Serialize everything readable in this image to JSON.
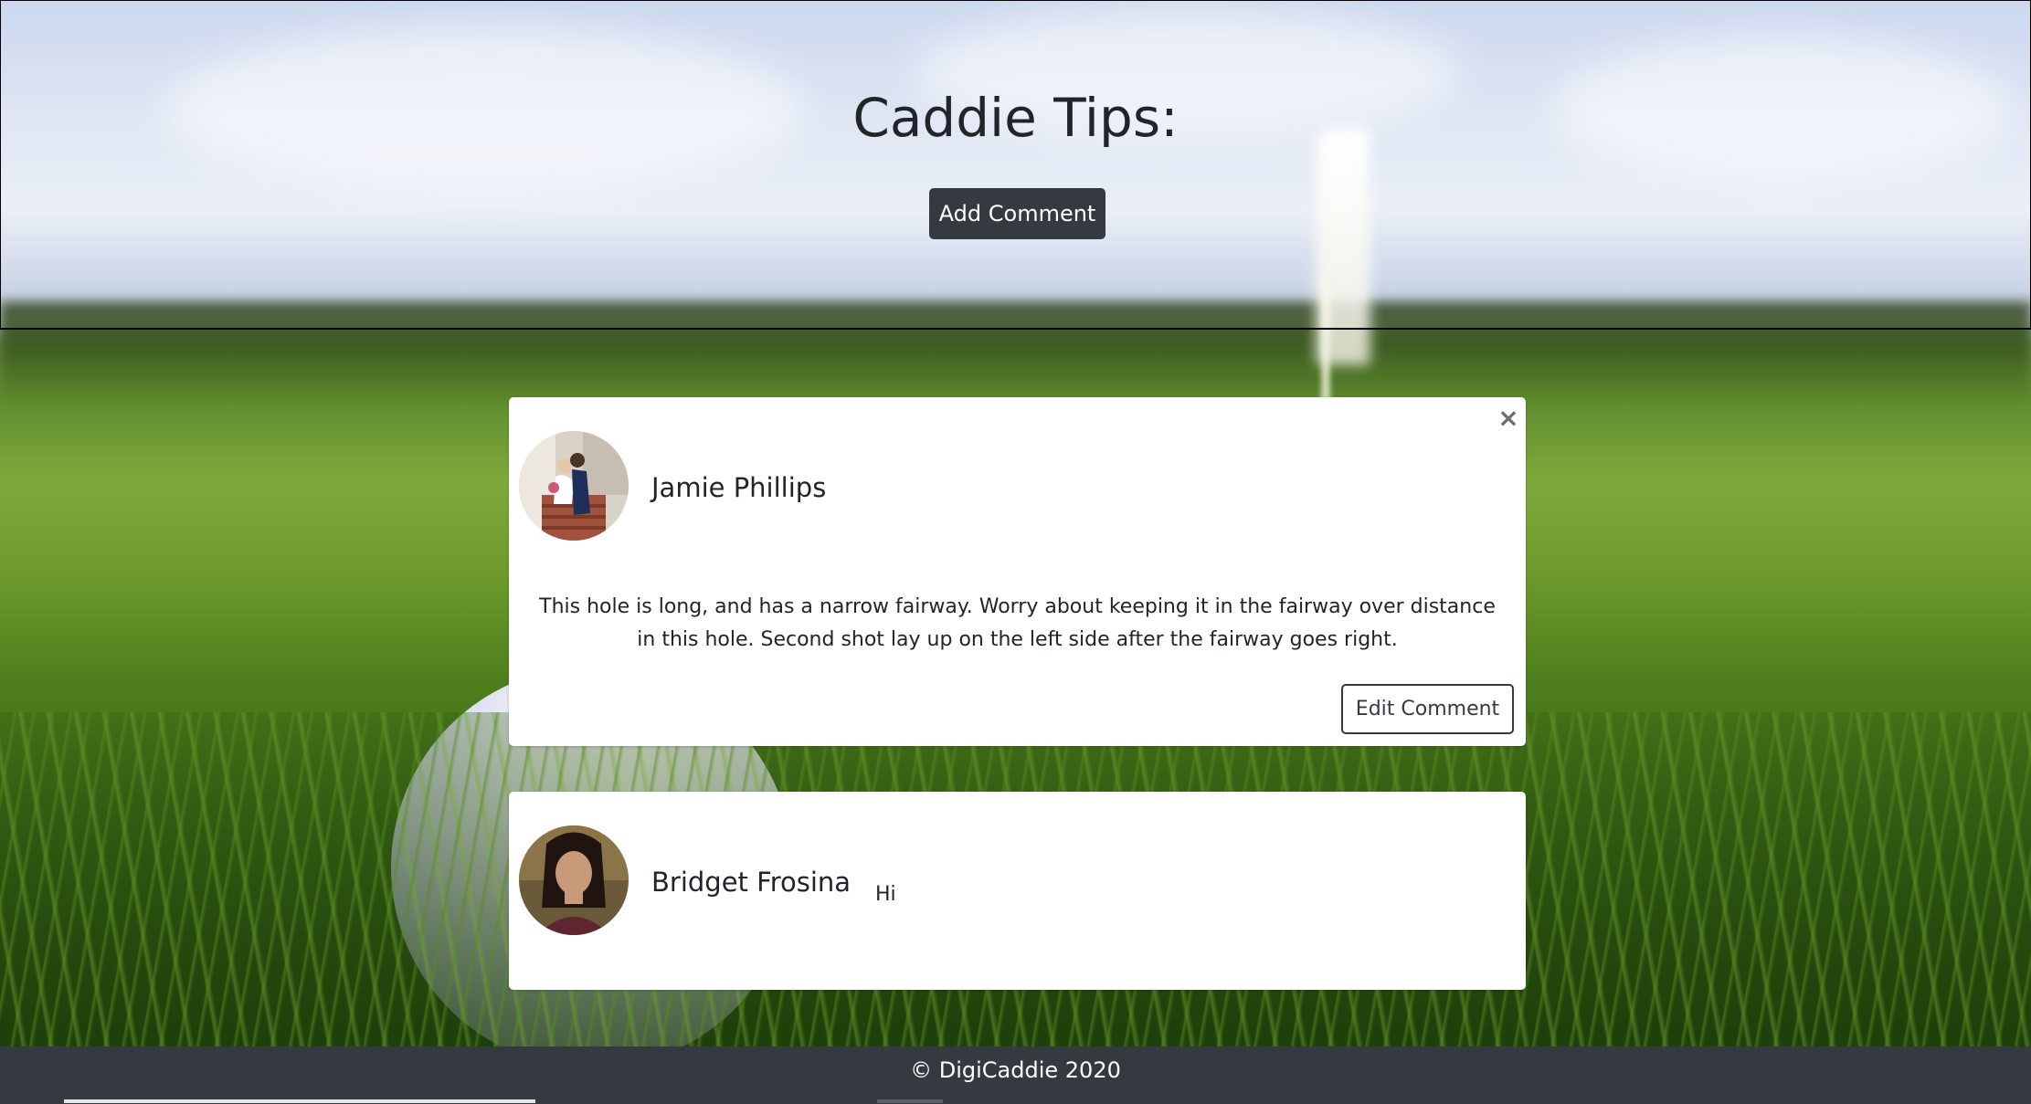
{
  "header": {
    "title": "Caddie Tips:",
    "add_label": "Add Comment"
  },
  "comments": [
    {
      "author": "Jamie Phillips",
      "text": "This hole is long, and has a narrow fairway. Worry about keeping it in the fairway over distance in this hole. Second shot lay up on the left side after the fairway goes right.",
      "edit_label": "Edit Comment",
      "close_label": "×"
    },
    {
      "author": "Bridget Frosina",
      "text": "Hi"
    }
  ],
  "footer": {
    "text": "© DigiCaddie 2020"
  },
  "colors": {
    "dark": "#343a40",
    "card": "#ffffff"
  },
  "icons": {
    "close": "close-icon"
  }
}
